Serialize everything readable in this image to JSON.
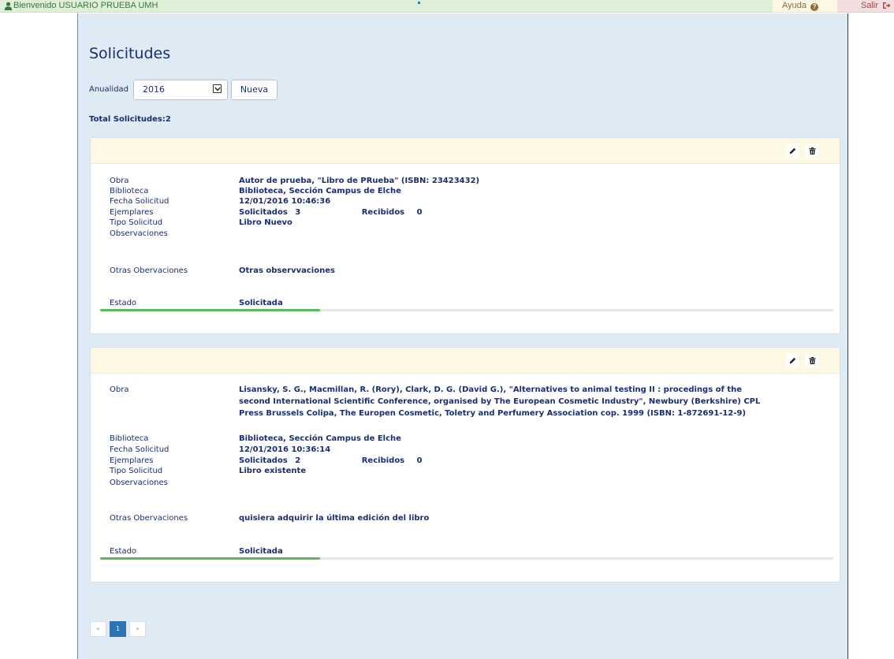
{
  "topbar": {
    "welcome": "Bienvenido USUARIO PRUEBA UMH",
    "help": "Ayuda",
    "logout": "Salir"
  },
  "page": {
    "title": "Solicitudes",
    "filter_label": "Anualidad",
    "year_selected": "2016",
    "new_button": "Nueva",
    "total_label": "Total Solicitudes:",
    "total_value": "2"
  },
  "labels": {
    "obra": "Obra",
    "biblioteca": "Biblioteca",
    "fecha": "Fecha Solicitud",
    "ejemplares": "Ejemplares",
    "tipo": "Tipo Solicitud",
    "observaciones": "Observaciones",
    "otras": "Otras Obervaciones",
    "estado": "Estado",
    "solicitados": "Solicitados",
    "recibidos": "Recibidos"
  },
  "requests": [
    {
      "obra": "Autor de prueba, \"Libro de PRueba\" (ISBN: 23423432)",
      "biblioteca": "Biblioteca, Sección Campus de Elche",
      "fecha": "12/01/2016 10:46:36",
      "solicitados": "3",
      "recibidos": "0",
      "tipo": "Libro Nuevo",
      "observaciones": "",
      "otras": "Otras observvaciones",
      "estado": "Solicitada",
      "progress": 0.3
    },
    {
      "obra": "Lisansky, S. G., Macmillan, R. (Rory), Clark, D. G. (David G.), \"Alternatives to animal testing II : procedings of the second International Scientific Conference, organised by The European Cosmetic Industry\", Newbury (Berkshire) CPL Press Brussels Colipa, The Europen Cosmetic, Toletry and Perfumery Association cop. 1999 (ISBN: 1-872691-12-9)",
      "biblioteca": "Biblioteca, Sección Campus de Elche",
      "fecha": "12/01/2016 10:36:14",
      "solicitados": "2",
      "recibidos": "0",
      "tipo": "Libro existente",
      "observaciones": "",
      "otras": "quisiera adquirir la última edición del libro",
      "estado": "Solicitada",
      "progress": 0.3
    }
  ],
  "pagination": {
    "prev": "«",
    "current": "1",
    "next": "»"
  },
  "colors": {
    "progress": "#5cb85c",
    "card_header": "#fcf8e3",
    "panel": "#deebf4"
  }
}
